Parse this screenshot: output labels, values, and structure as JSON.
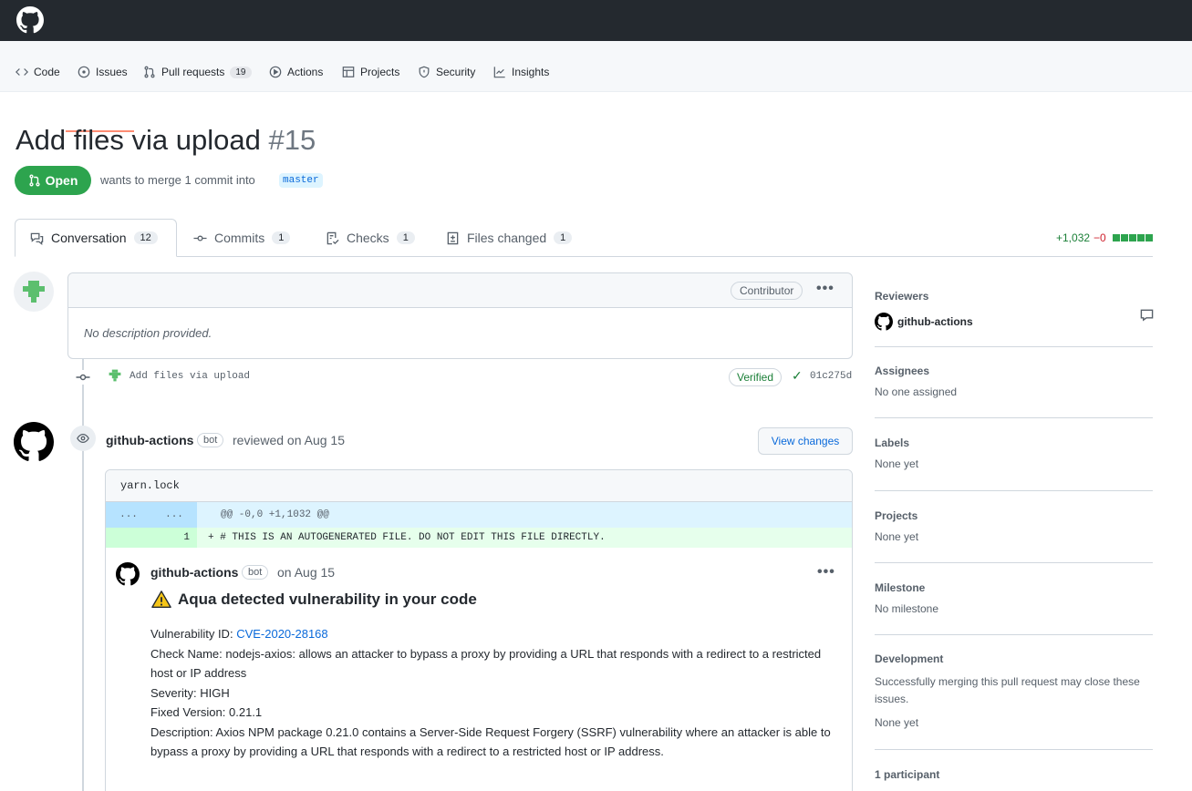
{
  "nav": {
    "items": [
      {
        "label": "Code",
        "icon": "code-icon"
      },
      {
        "label": "Issues",
        "icon": "issue-icon"
      },
      {
        "label": "Pull requests",
        "icon": "pull-request-icon",
        "count": "19"
      },
      {
        "label": "Actions",
        "icon": "play-icon"
      },
      {
        "label": "Projects",
        "icon": "table-icon"
      },
      {
        "label": "Security",
        "icon": "shield-icon"
      },
      {
        "label": "Insights",
        "icon": "graph-icon"
      }
    ]
  },
  "pr": {
    "title": "Add files via upload",
    "number": "#15",
    "state": "Open",
    "merge_text": "wants to merge 1 commit into",
    "base_branch": "master"
  },
  "tabs": [
    {
      "label": "Conversation",
      "count": "12"
    },
    {
      "label": "Commits",
      "count": "1"
    },
    {
      "label": "Checks",
      "count": "1"
    },
    {
      "label": "Files changed",
      "count": "1"
    }
  ],
  "diffstat": {
    "additions": "+1,032",
    "deletions": "−0"
  },
  "first_comment": {
    "role": "Contributor",
    "body": "No description provided."
  },
  "commit": {
    "message": "Add files via upload",
    "verified": "Verified",
    "sha": "01c275d"
  },
  "review": {
    "author": "github-actions",
    "bot": "bot",
    "meta": "reviewed on Aug 15",
    "view_changes": "View changes",
    "file": "yarn.lock",
    "hunk_left": "...",
    "hunk_right": "...",
    "hunk": "@@ -0,0 +1,1032 @@",
    "line_number": "1",
    "line_text": "+ # THIS IS AN AUTOGENERATED FILE. DO NOT EDIT THIS FILE DIRECTLY.",
    "comment": {
      "author": "github-actions",
      "bot": "bot",
      "meta": "on Aug 15",
      "title": "Aqua detected vulnerability in your code",
      "vuln_id_label": "Vulnerability ID:",
      "vuln_id": "CVE-2020-28168",
      "check_name_label": "Check Name:",
      "check_name": "nodejs-axios: allows an attacker to bypass a proxy by providing a URL that responds with a redirect to a restricted host or IP address",
      "severity_label": "Severity:",
      "severity": "HIGH",
      "fixed_label": "Fixed Version:",
      "fixed": "0.21.1",
      "description_label": "Description:",
      "description": "Axios NPM package 0.21.0 contains a Server-Side Request Forgery (SSRF) vulnerability where an attacker is able to bypass a proxy by providing a URL that responds with a redirect to a restricted host or IP address."
    }
  },
  "sidebar": {
    "reviewers": {
      "heading": "Reviewers",
      "name": "github-actions"
    },
    "assignees": {
      "heading": "Assignees",
      "value": "No one assigned"
    },
    "labels": {
      "heading": "Labels",
      "value": "None yet"
    },
    "projects": {
      "heading": "Projects",
      "value": "None yet"
    },
    "milestone": {
      "heading": "Milestone",
      "value": "No milestone"
    },
    "development": {
      "heading": "Development",
      "text": "Successfully merging this pull request may close these issues.",
      "value": "None yet"
    },
    "participants": {
      "heading": "1 participant"
    }
  },
  "colors": {
    "open_green": "#2da44e",
    "link_blue": "#0969da",
    "header_dark": "#24292f"
  }
}
